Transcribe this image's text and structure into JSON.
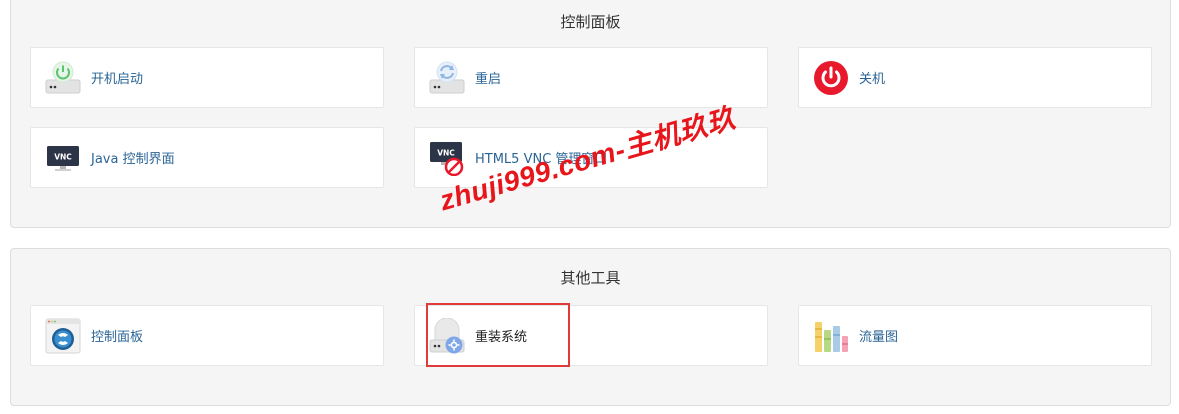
{
  "control_panel": {
    "title": "控制面板",
    "items": [
      {
        "label": "开机启动",
        "icon": "power-on-server-icon"
      },
      {
        "label": "重启",
        "icon": "restart-server-icon"
      },
      {
        "label": "关机",
        "icon": "shutdown-icon"
      },
      {
        "label": "Java 控制界面",
        "icon": "vnc-monitor-icon"
      },
      {
        "label": "HTML5 VNC 管理窗口",
        "icon": "vnc-monitor-disabled-icon"
      }
    ]
  },
  "other_tools": {
    "title": "其他工具",
    "items": [
      {
        "label": "控制面板",
        "icon": "solusvm-panel-icon"
      },
      {
        "label": "重装系统",
        "icon": "reinstall-os-icon"
      },
      {
        "label": "流量图",
        "icon": "traffic-chart-icon"
      }
    ]
  },
  "watermark": "zhuji999.com-主机玖玖",
  "colors": {
    "panel_bg": "#f5f5f5",
    "link": "#2a6496",
    "highlight": "#e03a3a",
    "shutdown_red": "#e8192c",
    "power_green": "#5cc36e"
  }
}
